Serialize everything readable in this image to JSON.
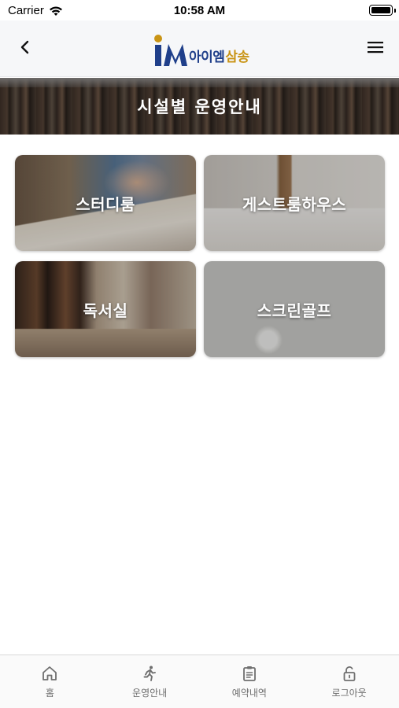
{
  "status_bar": {
    "carrier": "Carrier",
    "time": "10:58 AM",
    "wifi_icon": "wifi-icon",
    "battery_icon": "battery-icon"
  },
  "top_nav": {
    "back_icon": "chevron-left-icon",
    "menu_icon": "hamburger-menu-icon",
    "logo": {
      "mark": "IM",
      "text_primary": "아이엠",
      "text_secondary": "삼송",
      "colors": {
        "primary": "#1f3f8a",
        "secondary": "#c99415"
      }
    }
  },
  "hero": {
    "title": "시설별 운영안내"
  },
  "facilities": [
    {
      "label": "스터디룸"
    },
    {
      "label": "게스트룸하우스"
    },
    {
      "label": "독서실"
    },
    {
      "label": "스크린골프"
    }
  ],
  "tabbar": {
    "items": [
      {
        "label": "홈",
        "icon": "home-icon"
      },
      {
        "label": "운영안내",
        "icon": "runner-icon"
      },
      {
        "label": "예약내역",
        "icon": "clipboard-icon"
      },
      {
        "label": "로그아웃",
        "icon": "unlock-icon"
      }
    ],
    "icon_color": "#6f6f6f"
  }
}
